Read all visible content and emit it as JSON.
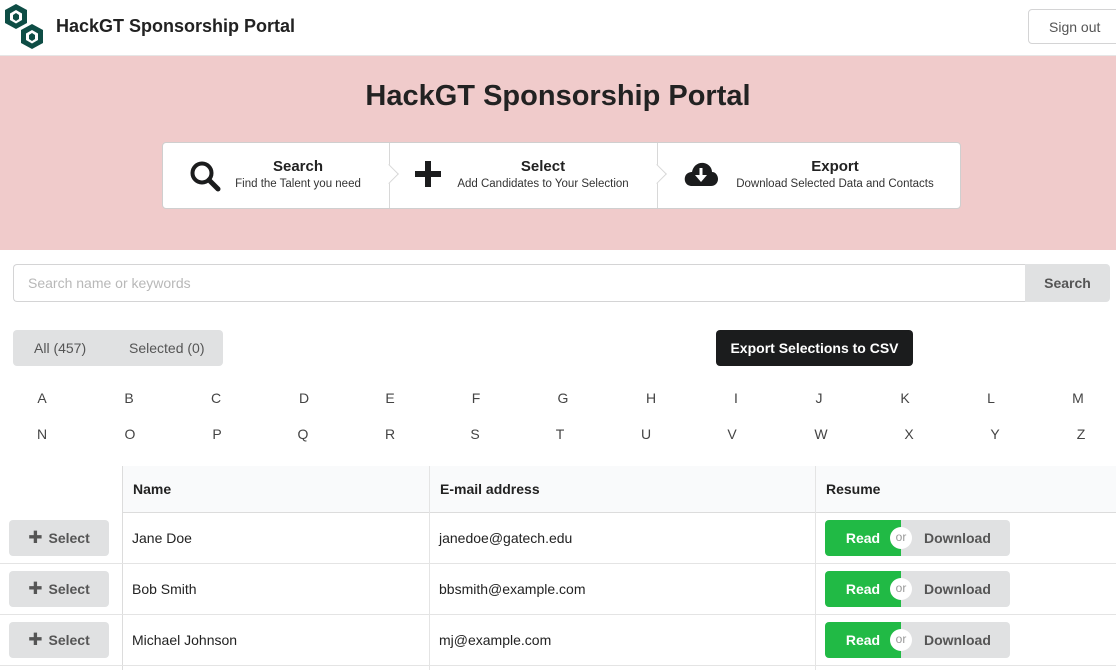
{
  "header": {
    "brand": "HackGT Sponsorship Portal",
    "sign_out": "Sign out"
  },
  "hero": {
    "title": "HackGT Sponsorship Portal",
    "steps": [
      {
        "icon": "search-icon",
        "title": "Search",
        "desc": "Find the Talent you need"
      },
      {
        "icon": "plus-icon",
        "title": "Select",
        "desc": "Add Candidates to Your Selection"
      },
      {
        "icon": "cloud-download-icon",
        "title": "Export",
        "desc": "Download Selected Data and Contacts"
      }
    ]
  },
  "search": {
    "placeholder": "Search name or keywords",
    "button": "Search"
  },
  "tabs": {
    "all": "All (457)",
    "selected": "Selected (0)"
  },
  "export_button": "Export Selections to CSV",
  "alphabet": [
    "A",
    "B",
    "C",
    "D",
    "E",
    "F",
    "G",
    "H",
    "I",
    "J",
    "K",
    "L",
    "M",
    "N",
    "O",
    "P",
    "Q",
    "R",
    "S",
    "T",
    "U",
    "V",
    "W",
    "X",
    "Y",
    "Z"
  ],
  "table": {
    "headers": {
      "name": "Name",
      "email": "E-mail address",
      "resume": "Resume"
    },
    "select_label": "Select",
    "read_label": "Read",
    "or_label": "or",
    "download_label": "Download",
    "rows": [
      {
        "name": "Jane Doe",
        "email": "janedoe@gatech.edu"
      },
      {
        "name": "Bob Smith",
        "email": "bbsmith@example.com"
      },
      {
        "name": "Michael Johnson",
        "email": "mj@example.com"
      }
    ]
  },
  "colors": {
    "hero_bg": "#f0cbcb",
    "read_green": "#21ba45",
    "export_black": "#1b1c1d",
    "logo_green": "#0e4d45"
  }
}
